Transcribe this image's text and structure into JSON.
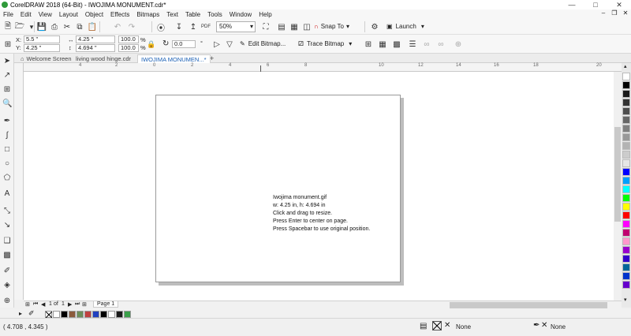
{
  "window": {
    "title": "CorelDRAW 2018 (64-Bit) - IWOJIMA MONUMENT.cdr*"
  },
  "menu": [
    "File",
    "Edit",
    "View",
    "Layout",
    "Object",
    "Effects",
    "Bitmaps",
    "Text",
    "Table",
    "Tools",
    "Window",
    "Help"
  ],
  "toolbar": {
    "zoom": "50%",
    "snap_label": "Snap To",
    "launch_label": "Launch"
  },
  "properties": {
    "x_label": "X:",
    "x_value": "5.5 \"",
    "y_label": "Y:",
    "y_value": "4.25 \"",
    "w_value": "4.25 \"",
    "h_value": "4.694 \"",
    "scale_w": "100.0",
    "scale_h": "100.0",
    "pct": "%",
    "rotation": "0.0",
    "edit_bitmap_label": "Edit Bitmap...",
    "trace_bitmap_label": "Trace Bitmap"
  },
  "tabs": [
    {
      "label": "Welcome Screen"
    },
    {
      "label": "living wood hinge.cdr"
    },
    {
      "label": "IWOJIMA MONUMEN...*"
    }
  ],
  "ruler": {
    "unit": "inches",
    "labels": [
      "4",
      "2",
      "0",
      "2",
      "4",
      "6",
      "8",
      "10",
      "12",
      "14",
      "16",
      "18",
      "20"
    ]
  },
  "canvas_hint": {
    "line1": "Iwojima monument.gif",
    "line2": "w: 4.25 in, h: 4.694 in",
    "line3": "Click and drag to resize.",
    "line4": "Press Enter to center on page.",
    "line5": "Press Spacebar to use original position."
  },
  "page_nav": {
    "current": "1",
    "of_label": "of",
    "total": "1",
    "page_tab": "Page 1"
  },
  "statusbar": {
    "coords": "( 4.708 , 4.345 )",
    "fill_label": "None",
    "outline_label": "None"
  },
  "colors": {
    "accent": "#1a5fb4",
    "palette": [
      "#ffffff",
      "#000000",
      "#1a1a1a",
      "#333333",
      "#4d4d4d",
      "#666666",
      "#808080",
      "#999999",
      "#b3b3b3",
      "#cccccc",
      "#e6e6e6",
      "#0000ff",
      "#00a0ff",
      "#00ffff",
      "#00ff00",
      "#ffff00",
      "#ff0000",
      "#ff00ff",
      "#c0006f",
      "#ff99cc",
      "#9900cc",
      "#3300cc",
      "#006699",
      "#0033cc",
      "#6600cc"
    ],
    "document_palette": [
      "#ffffff",
      "#000000",
      "#8b5a3c",
      "#6b8e5a",
      "#c04040",
      "#2040c0",
      "#000000",
      "#ffffff",
      "#1a1a1a",
      "#3aa04a"
    ]
  }
}
